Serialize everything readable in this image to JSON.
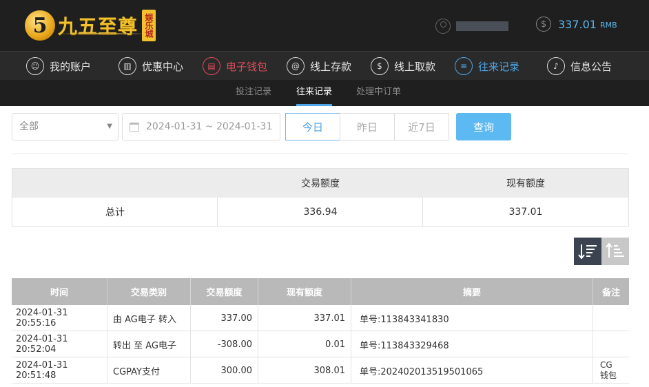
{
  "brand": {
    "mark": "5",
    "name": "九五至尊",
    "tag": "娱乐城"
  },
  "account": {
    "username": "",
    "balance": "337.01",
    "unit": "RMB"
  },
  "main_nav": [
    {
      "label": "我的账户",
      "icon": "user-icon",
      "state": "normal"
    },
    {
      "label": "优惠中心",
      "icon": "gift-icon",
      "state": "normal"
    },
    {
      "label": "电子钱包",
      "icon": "wallet-icon",
      "state": "red"
    },
    {
      "label": "线上存款",
      "icon": "deposit-icon",
      "state": "normal"
    },
    {
      "label": "线上取款",
      "icon": "withdraw-icon",
      "state": "normal"
    },
    {
      "label": "往来记录",
      "icon": "record-icon",
      "state": "active"
    },
    {
      "label": "信息公告",
      "icon": "bell-icon",
      "state": "normal"
    }
  ],
  "sub_nav": [
    {
      "label": "投注记录",
      "active": false
    },
    {
      "label": "往来记录",
      "active": true
    },
    {
      "label": "处理中订单",
      "active": false
    }
  ],
  "filters": {
    "type_select": "全部",
    "date_range": "2024-01-31 ~ 2024-01-31",
    "quick": [
      "今日",
      "昨日",
      "近7日"
    ],
    "quick_active": 0,
    "search_label": "查询"
  },
  "summary": {
    "headers": [
      "",
      "交易额度",
      "现有额度"
    ],
    "row": [
      "总计",
      "336.94",
      "337.01"
    ]
  },
  "records": {
    "headers": [
      "时间",
      "交易类别",
      "交易额度",
      "现有额度",
      "摘要",
      "备注"
    ],
    "rows": [
      [
        "2024-01-31 20:55:16",
        "由 AG电子 转入",
        "337.00",
        "337.01",
        "单号:113843341830",
        ""
      ],
      [
        "2024-01-31 20:52:04",
        "转出 至 AG电子",
        "-308.00",
        "0.01",
        "单号:113843329468",
        ""
      ],
      [
        "2024-01-31 20:51:48",
        "CGPAY支付",
        "300.00",
        "308.01",
        "单号:202402013519501065",
        "CG钱包"
      ]
    ]
  },
  "colors": {
    "accent_blue": "#4ea6e8",
    "accent_red": "#e24b5b",
    "header_bg": "#1f1f1f",
    "balance": "#5bb8ef",
    "search_button": "#5cb9f2"
  }
}
